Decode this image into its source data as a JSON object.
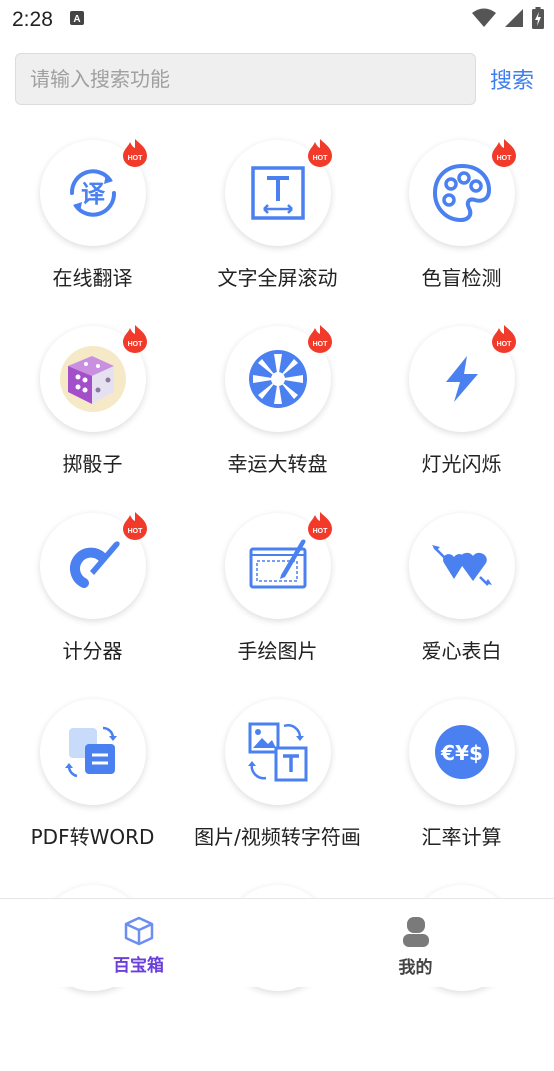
{
  "status_bar": {
    "time": "2:28",
    "notification_icon": "keyboard-a-icon",
    "icons": [
      "wifi-icon",
      "signal-icon",
      "battery-charging-icon"
    ]
  },
  "search": {
    "placeholder": "请输入搜索功能",
    "value": "",
    "button_label": "搜索"
  },
  "tools": [
    {
      "label": "在线翻译",
      "icon": "translate-icon",
      "hot": true
    },
    {
      "label": "文字全屏滚动",
      "icon": "text-scroll-icon",
      "hot": true
    },
    {
      "label": "色盲检测",
      "icon": "palette-icon",
      "hot": true
    },
    {
      "label": "掷骰子",
      "icon": "dice-icon",
      "hot": true
    },
    {
      "label": "幸运大转盘",
      "icon": "wheel-icon",
      "hot": true
    },
    {
      "label": "灯光闪烁",
      "icon": "lightning-icon",
      "hot": true
    },
    {
      "label": "计分器",
      "icon": "counter-icon",
      "hot": true
    },
    {
      "label": "手绘图片",
      "icon": "drawing-tablet-icon",
      "hot": true
    },
    {
      "label": "爱心表白",
      "icon": "hearts-icon",
      "hot": false
    },
    {
      "label": "PDF转WORD",
      "icon": "pdf-to-word-icon",
      "hot": false
    },
    {
      "label": "图片/视频转字符画",
      "icon": "image-to-text-icon",
      "hot": false
    },
    {
      "label": "汇率计算",
      "icon": "currency-icon",
      "hot": false
    }
  ],
  "hot_badge_text": "HOT",
  "tabbar": {
    "tabs": [
      {
        "label": "百宝箱",
        "icon": "cube-icon",
        "active": true
      },
      {
        "label": "我的",
        "icon": "person-icon",
        "active": false
      }
    ]
  },
  "colors": {
    "accent": "#3f7ef0",
    "icon_blue": "#4a80f0",
    "active_tab": "#6a3fdb",
    "hot_red": "#f23a2a"
  }
}
